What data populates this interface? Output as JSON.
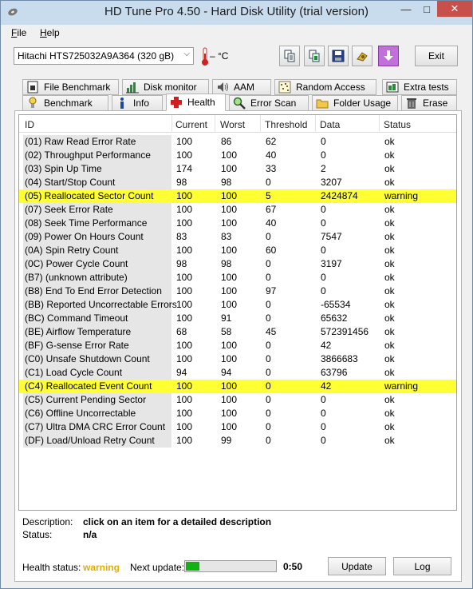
{
  "window": {
    "title": "HD Tune Pro 4.50 - Hard Disk Utility (trial version)",
    "min_glyph": "—",
    "max_glyph": "□",
    "close_glyph": "✕"
  },
  "menu": {
    "file_first": "F",
    "file_rest": "ile",
    "help_first": "H",
    "help_rest": "elp"
  },
  "toolbar": {
    "drive": "Hitachi HTS725032A9A364 (320 gB)",
    "drive_arrow": "⌵",
    "temperature": "– °C",
    "exit_label": "Exit",
    "icons": [
      "copy-text-icon",
      "copy-screenshot-icon",
      "save-icon",
      "options-icon",
      "download-icon"
    ]
  },
  "tabs": {
    "row_top": [
      {
        "label": "File Benchmark",
        "icon": "file-benchmark-icon"
      },
      {
        "label": "Disk monitor",
        "icon": "disk-monitor-icon"
      },
      {
        "label": "AAM",
        "icon": "speaker-icon"
      },
      {
        "label": "Random Access",
        "icon": "random-access-icon"
      },
      {
        "label": "Extra tests",
        "icon": "extra-tests-icon"
      }
    ],
    "row_bottom": [
      {
        "label": "Benchmark",
        "icon": "benchmark-icon"
      },
      {
        "label": "Info",
        "icon": "info-icon"
      },
      {
        "label": "Health",
        "icon": "health-cross-icon"
      },
      {
        "label": "Error Scan",
        "icon": "magnifier-icon"
      },
      {
        "label": "Folder Usage",
        "icon": "folder-icon"
      },
      {
        "label": "Erase",
        "icon": "trash-icon"
      }
    ],
    "active": "Health"
  },
  "table": {
    "headers": [
      "ID",
      "Current",
      "Worst",
      "Threshold",
      "Data",
      "Status"
    ],
    "rows": [
      {
        "id": "(01) Raw Read Error Rate",
        "current": "100",
        "worst": "86",
        "threshold": "62",
        "data": "0",
        "status": "ok"
      },
      {
        "id": "(02) Throughput Performance",
        "current": "100",
        "worst": "100",
        "threshold": "40",
        "data": "0",
        "status": "ok"
      },
      {
        "id": "(03) Spin Up Time",
        "current": "174",
        "worst": "100",
        "threshold": "33",
        "data": "2",
        "status": "ok"
      },
      {
        "id": "(04) Start/Stop Count",
        "current": "98",
        "worst": "98",
        "threshold": "0",
        "data": "3207",
        "status": "ok"
      },
      {
        "id": "(05) Reallocated Sector Count",
        "current": "100",
        "worst": "100",
        "threshold": "5",
        "data": "2424874",
        "status": "warning"
      },
      {
        "id": "(07) Seek Error Rate",
        "current": "100",
        "worst": "100",
        "threshold": "67",
        "data": "0",
        "status": "ok"
      },
      {
        "id": "(08) Seek Time Performance",
        "current": "100",
        "worst": "100",
        "threshold": "40",
        "data": "0",
        "status": "ok"
      },
      {
        "id": "(09) Power On Hours Count",
        "current": "83",
        "worst": "83",
        "threshold": "0",
        "data": "7547",
        "status": "ok"
      },
      {
        "id": "(0A) Spin Retry Count",
        "current": "100",
        "worst": "100",
        "threshold": "60",
        "data": "0",
        "status": "ok"
      },
      {
        "id": "(0C) Power Cycle Count",
        "current": "98",
        "worst": "98",
        "threshold": "0",
        "data": "3197",
        "status": "ok"
      },
      {
        "id": "(B7) (unknown attribute)",
        "current": "100",
        "worst": "100",
        "threshold": "0",
        "data": "0",
        "status": "ok"
      },
      {
        "id": "(B8) End To End Error Detection",
        "current": "100",
        "worst": "100",
        "threshold": "97",
        "data": "0",
        "status": "ok"
      },
      {
        "id": "(BB) Reported Uncorrectable Errors",
        "current": "100",
        "worst": "100",
        "threshold": "0",
        "data": "-65534",
        "status": "ok"
      },
      {
        "id": "(BC) Command Timeout",
        "current": "100",
        "worst": "91",
        "threshold": "0",
        "data": "65632",
        "status": "ok"
      },
      {
        "id": "(BE) Airflow Temperature",
        "current": "68",
        "worst": "58",
        "threshold": "45",
        "data": "572391456",
        "status": "ok"
      },
      {
        "id": "(BF) G-sense Error Rate",
        "current": "100",
        "worst": "100",
        "threshold": "0",
        "data": "42",
        "status": "ok"
      },
      {
        "id": "(C0) Unsafe Shutdown Count",
        "current": "100",
        "worst": "100",
        "threshold": "0",
        "data": "3866683",
        "status": "ok"
      },
      {
        "id": "(C1) Load Cycle Count",
        "current": "94",
        "worst": "94",
        "threshold": "0",
        "data": "63796",
        "status": "ok"
      },
      {
        "id": "(C4) Reallocated Event Count",
        "current": "100",
        "worst": "100",
        "threshold": "0",
        "data": "42",
        "status": "warning"
      },
      {
        "id": "(C5) Current Pending Sector",
        "current": "100",
        "worst": "100",
        "threshold": "0",
        "data": "0",
        "status": "ok"
      },
      {
        "id": "(C6) Offline Uncorrectable",
        "current": "100",
        "worst": "100",
        "threshold": "0",
        "data": "0",
        "status": "ok"
      },
      {
        "id": "(C7) Ultra DMA CRC Error Count",
        "current": "100",
        "worst": "100",
        "threshold": "0",
        "data": "0",
        "status": "ok"
      },
      {
        "id": "(DF) Load/Unload Retry Count",
        "current": "100",
        "worst": "99",
        "threshold": "0",
        "data": "0",
        "status": "ok"
      }
    ]
  },
  "detail": {
    "description_label": "Description:",
    "description_value": "click on an item for a detailed description",
    "status_label": "Status:",
    "status_value": "n/a"
  },
  "footer": {
    "health_label": "Health status:",
    "health_value": "warning",
    "next_update_label": "Next update:",
    "progress_fraction": 0.15,
    "countdown": "0:50",
    "update_label": "Update",
    "log_label": "Log"
  },
  "colors": {
    "warning_row": "#ffff33",
    "warning_text": "#e0b000",
    "progress": "#12b212"
  }
}
